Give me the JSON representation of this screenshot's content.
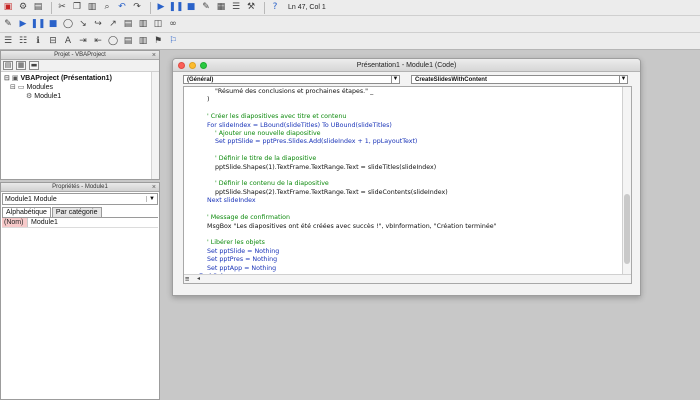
{
  "toolbar": {
    "status": "Ln 47, Col 1"
  },
  "project_panel": {
    "title": "Projet - VBAProject",
    "tree": {
      "root": "VBAProject (Présentation1)",
      "folder": "Modules",
      "module": "Module1"
    }
  },
  "properties_panel": {
    "title": "Propriétés - Module1",
    "object_combo": "Module1 Module",
    "tabs": [
      "Alphabétique",
      "Par catégorie"
    ],
    "property": {
      "key": "(Nom)",
      "value": "Module1"
    }
  },
  "code_window": {
    "title": "Présentation1 - Module1 (Code)",
    "object_select": "(Général)",
    "procedure_select": "CreateSlidesWithContent",
    "lines": [
      {
        "kind": "t",
        "text": "        \"Résumé des conclusions et prochaines étapes.\" _"
      },
      {
        "kind": "t",
        "text": "    )"
      },
      {
        "kind": "t",
        "text": ""
      },
      {
        "kind": "c",
        "text": "    ' Créer les diapositives avec titre et contenu"
      },
      {
        "kind": "k",
        "text": "    For slideIndex = LBound(slideTitles) To UBound(slideTitles)"
      },
      {
        "kind": "c",
        "text": "        ' Ajouter une nouvelle diapositive"
      },
      {
        "kind": "k",
        "text": "        Set pptSlide = pptPres.Slides.Add(slideIndex + 1, ppLayoutText)"
      },
      {
        "kind": "t",
        "text": ""
      },
      {
        "kind": "c",
        "text": "        ' Définir le titre de la diapositive"
      },
      {
        "kind": "t",
        "text": "        pptSlide.Shapes(1).TextFrame.TextRange.Text = slideTitles(slideIndex)"
      },
      {
        "kind": "t",
        "text": ""
      },
      {
        "kind": "c",
        "text": "        ' Définir le contenu de la diapositive"
      },
      {
        "kind": "t",
        "text": "        pptSlide.Shapes(2).TextFrame.TextRange.Text = slideContents(slideIndex)"
      },
      {
        "kind": "k",
        "text": "    Next slideIndex"
      },
      {
        "kind": "t",
        "text": ""
      },
      {
        "kind": "c",
        "text": "    ' Message de confirmation"
      },
      {
        "kind": "t",
        "text": "    MsgBox \"Les diapositives ont été créées avec succès !\", vbInformation, \"Création terminée\""
      },
      {
        "kind": "t",
        "text": ""
      },
      {
        "kind": "c",
        "text": "    ' Libérer les objets"
      },
      {
        "kind": "k",
        "text": "    Set pptSlide = Nothing"
      },
      {
        "kind": "k",
        "text": "    Set pptPres = Nothing"
      },
      {
        "kind": "k",
        "text": "    Set pptApp = Nothing"
      },
      {
        "kind": "k",
        "text": "End Sub"
      }
    ]
  }
}
